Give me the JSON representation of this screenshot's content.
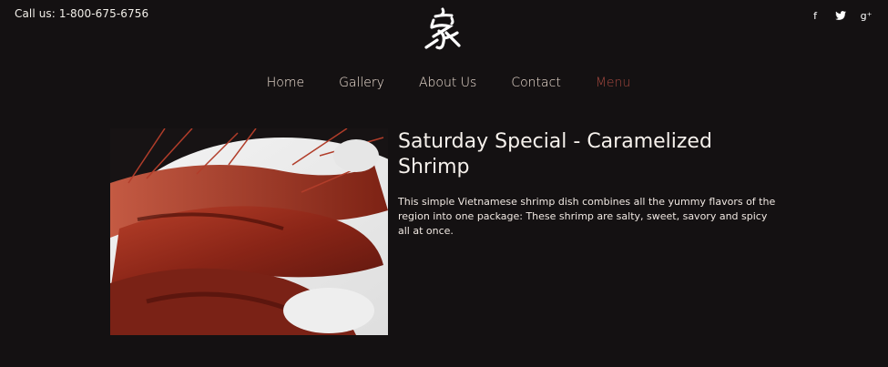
{
  "header": {
    "phone_text": "Call us: 1-800-675-6756",
    "social": [
      {
        "icon": "facebook-icon",
        "glyph": "f"
      },
      {
        "icon": "twitter-icon",
        "glyph": "❧"
      },
      {
        "icon": "google-plus-icon",
        "glyph": "g⁺"
      }
    ]
  },
  "nav": {
    "items": [
      {
        "label": "Home"
      },
      {
        "label": "Gallery"
      },
      {
        "label": "About Us"
      },
      {
        "label": "Contact"
      },
      {
        "label": "Menu",
        "active": true
      }
    ]
  },
  "article": {
    "title": "Saturday Special - Caramelized Shrimp",
    "body": "This simple Vietnamese shrimp dish combines all the yummy flavors of the region into one package: These shrimp are salty, sweet, savory and spicy all at once.",
    "image": "caramelized-shrimp-photo"
  },
  "colors": {
    "background": "#141112",
    "nav_text": "#f3e4d8",
    "nav_active": "#a3473e",
    "shrimp_red": "#8e2a1c"
  }
}
